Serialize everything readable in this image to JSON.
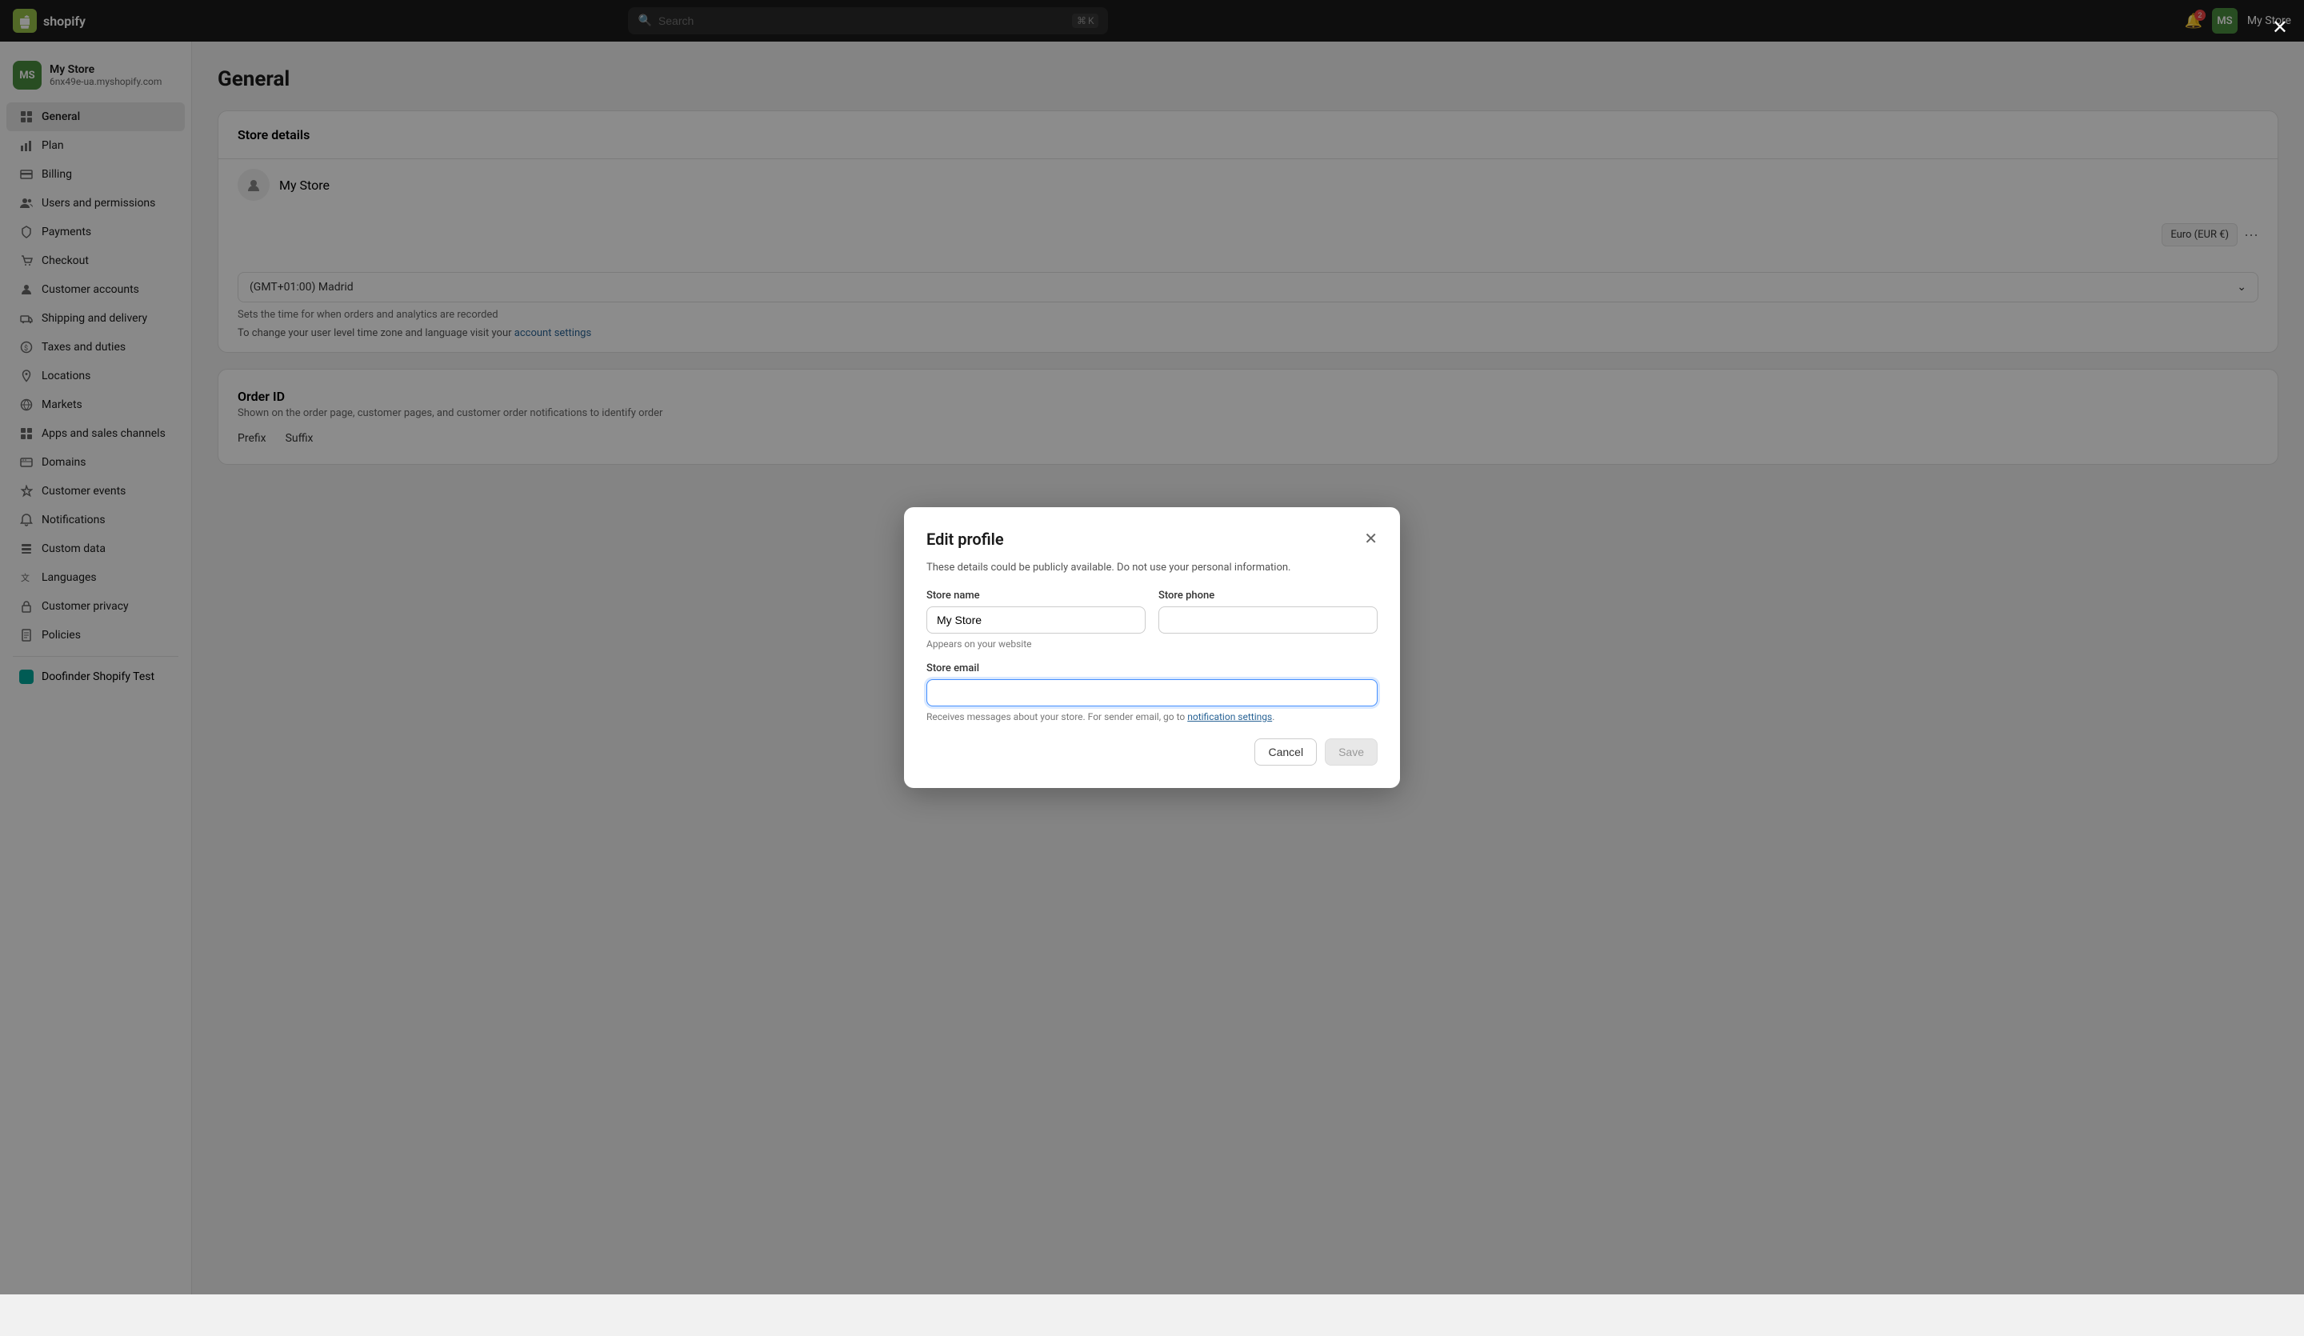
{
  "topnav": {
    "logo_text": "shopify",
    "logo_initials": "S",
    "search_placeholder": "Search",
    "shortcut_key1": "⌘",
    "shortcut_key2": "K",
    "notif_count": "2",
    "user_initials": "MS",
    "store_label": "My Store"
  },
  "sidebar": {
    "store_initials": "MS",
    "store_name": "My Store",
    "store_url": "6nx49e-ua.myshopify.com",
    "nav_items": [
      {
        "id": "general",
        "label": "General",
        "icon": "home"
      },
      {
        "id": "plan",
        "label": "Plan",
        "icon": "chart"
      },
      {
        "id": "billing",
        "label": "Billing",
        "icon": "billing"
      },
      {
        "id": "users",
        "label": "Users and permissions",
        "icon": "users"
      },
      {
        "id": "payments",
        "label": "Payments",
        "icon": "payments"
      },
      {
        "id": "checkout",
        "label": "Checkout",
        "icon": "checkout"
      },
      {
        "id": "customer-accounts",
        "label": "Customer accounts",
        "icon": "customer-accounts"
      },
      {
        "id": "shipping",
        "label": "Shipping and delivery",
        "icon": "shipping"
      },
      {
        "id": "taxes",
        "label": "Taxes and duties",
        "icon": "taxes"
      },
      {
        "id": "locations",
        "label": "Locations",
        "icon": "locations"
      },
      {
        "id": "markets",
        "label": "Markets",
        "icon": "markets"
      },
      {
        "id": "apps",
        "label": "Apps and sales channels",
        "icon": "apps"
      },
      {
        "id": "domains",
        "label": "Domains",
        "icon": "domains"
      },
      {
        "id": "customer-events",
        "label": "Customer events",
        "icon": "customer-events"
      },
      {
        "id": "notifications",
        "label": "Notifications",
        "icon": "notifications"
      },
      {
        "id": "custom-data",
        "label": "Custom data",
        "icon": "custom-data"
      },
      {
        "id": "languages",
        "label": "Languages",
        "icon": "languages"
      },
      {
        "id": "customer-privacy",
        "label": "Customer privacy",
        "icon": "customer-privacy"
      },
      {
        "id": "policies",
        "label": "Policies",
        "icon": "policies"
      }
    ],
    "app_items": [
      {
        "id": "doofinder",
        "label": "Doofinder Shopify Test"
      }
    ]
  },
  "page": {
    "title": "General",
    "store_details_title": "Store details",
    "store_name_display": "My Store",
    "currency_label": "Euro (EUR €)",
    "timezone_value": "(GMT+01:00) Madrid",
    "timezone_hint": "Sets the time for when orders and analytics are recorded",
    "account_settings_link": "account settings",
    "account_settings_text": "To change your user level time zone and language visit your",
    "order_id_title": "Order ID",
    "order_id_desc": "Shown on the order page, customer pages, and customer order notifications to identify order",
    "prefix_label": "Prefix",
    "suffix_label": "Suffix"
  },
  "modal": {
    "title": "Edit profile",
    "description": "These details could be publicly available. Do not use your personal information.",
    "store_name_label": "Store name",
    "store_name_value": "My Store",
    "store_name_hint": "Appears on your website",
    "store_phone_label": "Store phone",
    "store_phone_value": "",
    "store_email_label": "Store email",
    "store_email_value": "",
    "store_email_hint": "Receives messages about your store. For sender email, go to",
    "notification_settings_link": "notification settings",
    "cancel_label": "Cancel",
    "save_label": "Save"
  }
}
